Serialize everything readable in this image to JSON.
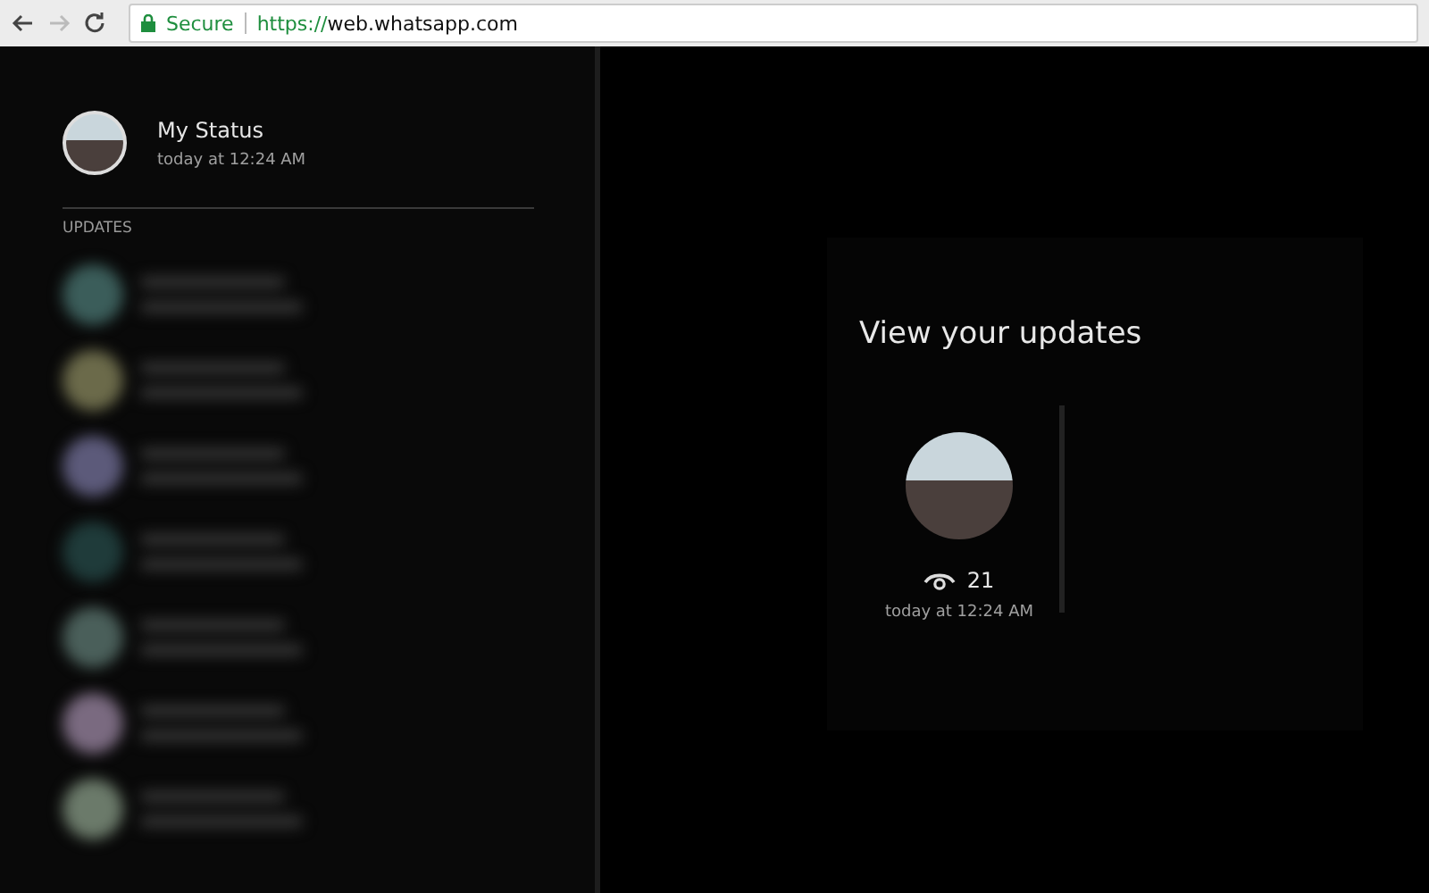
{
  "browser": {
    "security": "Secure",
    "url_scheme": "https://",
    "url_host": "web.whatsapp.com"
  },
  "my_status": {
    "name": "My Status",
    "time": "today at 12:24 AM"
  },
  "updates": {
    "heading": "UPDATES"
  },
  "viewer": {
    "title": "View your updates",
    "views": "21",
    "time": "today at 12:24 AM"
  }
}
